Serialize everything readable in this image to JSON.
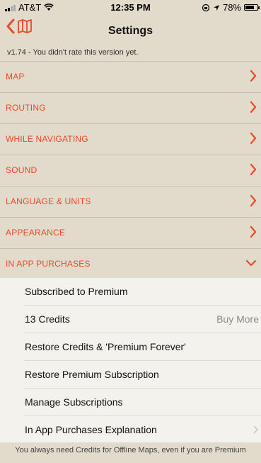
{
  "status_bar": {
    "carrier": "AT&T",
    "time": "12:35 PM",
    "battery": "78%",
    "battery_level": 0.78
  },
  "nav": {
    "title": "Settings",
    "back_icon": "back-chevron-icon",
    "map_icon": "map-icon"
  },
  "version_text": "v1.74 - You didn't rate this version yet.",
  "sections": [
    {
      "label": "MAP",
      "state": "collapsed"
    },
    {
      "label": "ROUTING",
      "state": "collapsed"
    },
    {
      "label": "WHILE NAVIGATING",
      "state": "collapsed"
    },
    {
      "label": "SOUND",
      "state": "collapsed"
    },
    {
      "label": "LANGUAGE & UNITS",
      "state": "collapsed"
    },
    {
      "label": "APPEARANCE",
      "state": "collapsed"
    },
    {
      "label": "IN APP PURCHASES",
      "state": "expanded"
    }
  ],
  "purchases": {
    "subscribed": "Subscribed to Premium",
    "credits": "13 Credits",
    "buy_more": "Buy More",
    "restore_credits": "Restore Credits & 'Premium Forever'",
    "restore_subscription": "Restore Premium Subscription",
    "manage": "Manage Subscriptions",
    "explanation": "In App Purchases Explanation"
  },
  "footer": "You always need Credits for Offline Maps, even if you are Premium",
  "colors": {
    "accent": "#e84a2a",
    "background": "#e2dacb",
    "panel": "#f4f2ec"
  }
}
